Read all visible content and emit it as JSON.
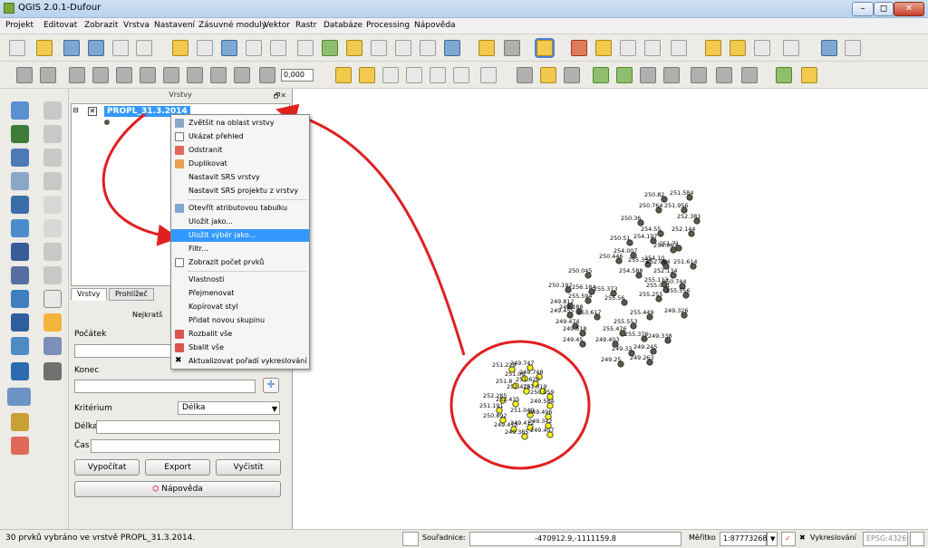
{
  "window": {
    "title": "QGIS 2.0.1-Dufour",
    "controls": {
      "minimize": "–",
      "maximize": "◻",
      "close": "✕"
    }
  },
  "menu": [
    "Projekt",
    "Editovat",
    "Zobrazit",
    "Vrstva",
    "Nastavení",
    "Zásuvné moduly",
    "Vektor",
    "Rastr",
    "Databáze",
    "Processing",
    "Nápověda"
  ],
  "toolbar2": {
    "scale_input": "0,000"
  },
  "layers_panel": {
    "header": "Vrstvy",
    "header_buttons": "🗗✕",
    "layer_name": "PROPL_31.3.2014"
  },
  "tabs": [
    "Vrstvy",
    "Prohlížeč"
  ],
  "route_panel": {
    "header": "Nejkratš",
    "start_label": "Počátek",
    "end_label": "Konec",
    "criterion_label": "Kritérium",
    "criterion_value": "Délka",
    "length_label": "Délka",
    "time_label": "Čas",
    "calc_button": "Vypočítat",
    "export_button": "Export",
    "clear_button": "Vyčistit",
    "help_button": "Nápověda"
  },
  "context_menu": {
    "items": [
      "Zvětšit na oblast vrstvy",
      "Ukázat přehled",
      "Odstranit",
      "Duplikovat",
      "Nastavit SRS vrstvy",
      "Nastavit SRS projektu z vrstvy",
      "Otevřít atributovou tabulku",
      "Uložit jako...",
      "Uložit výběr jako...",
      "Filtr...",
      "Zobrazit počet prvků",
      "Vlastnosti",
      "Přejmenovat",
      "Kopírovat styl",
      "Přidat novou skupinu",
      "Rozbalit vše",
      "Sbalit vše",
      "Aktualizovat pořadí vykreslování"
    ],
    "highlighted": "Uložit výběr jako..."
  },
  "map": {
    "colors": {
      "point": "#5a5a4a",
      "selected": "#f5f51a",
      "arrow": "#e02020"
    },
    "selected_labels": [
      "251.229",
      "249.747",
      "249.748",
      "251.06",
      "251.620",
      "251.8",
      "252.478",
      "251.019",
      "250.059",
      "252.285",
      "252.435",
      "249.584",
      "251.191",
      "251.049",
      "249.496",
      "250.892",
      "249.342",
      "249.470",
      "249.412",
      "249.407",
      "249.385"
    ],
    "other_labels": [
      "250.82",
      "251.584",
      "250.764",
      "251.956",
      "250.36",
      "252.381",
      "254.55",
      "252.144",
      "250.51",
      "254.197",
      "251.71",
      "254.007",
      "254.067",
      "250.446",
      "255.334",
      "254.10",
      "252.084",
      "251.614",
      "250.045",
      "254.588",
      "252.134",
      "250.744",
      "250.192",
      "256.184",
      "255.373",
      "255.081",
      "255.113",
      "255.556",
      "255.594",
      "255.56",
      "249.812",
      "255.255",
      "249.455",
      "249.188",
      "253.617",
      "255.449",
      "249.326",
      "249.474",
      "255.553",
      "249.518",
      "255.476",
      "255.376",
      "249.338",
      "249.45",
      "249.403",
      "249.245",
      "249.33",
      "249.263",
      "249.25"
    ]
  },
  "status": {
    "message": "30 prvků vybráno ve vrstvě PROPL_31.3.2014.",
    "coords_label": "Souřadnice:",
    "coords_value": "-470912.9,-1111159.8",
    "scale_label": "Měřítko",
    "scale_value": "1:87773268",
    "render_label": "Vykreslování",
    "crs": "EPSG:4326"
  }
}
